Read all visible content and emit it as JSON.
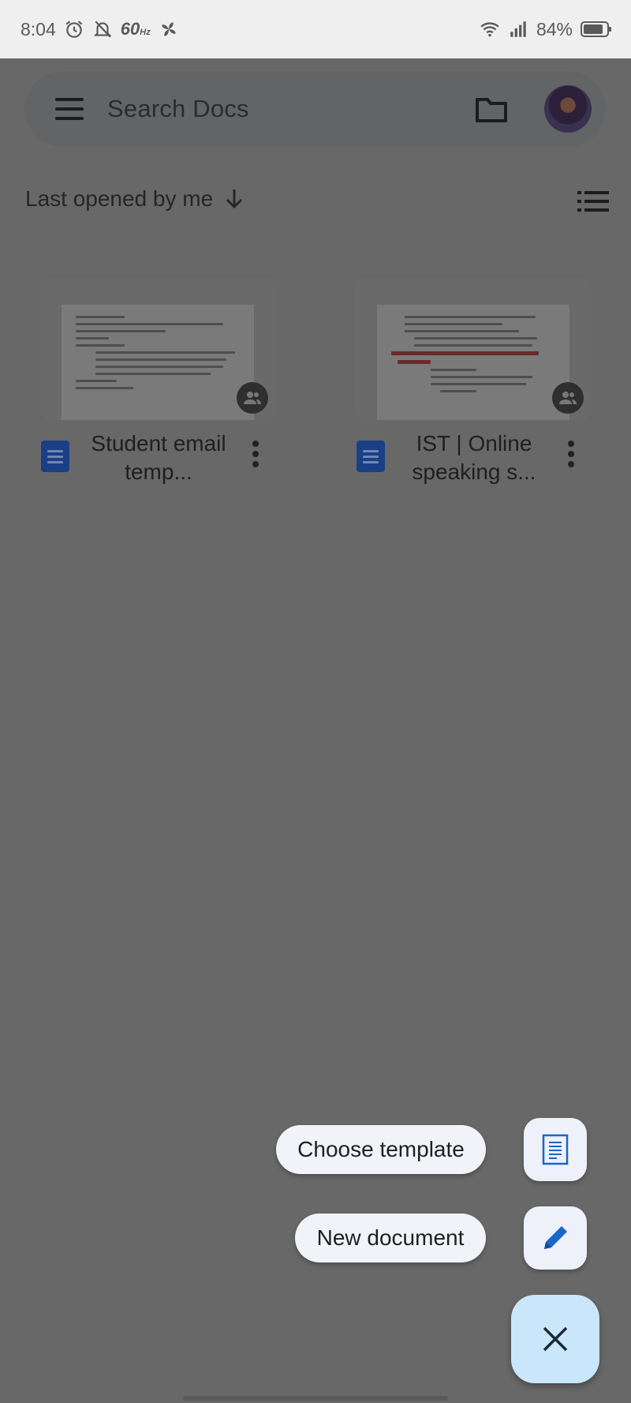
{
  "status_bar": {
    "time": "8:04",
    "refresh_rate": "60",
    "refresh_unit": "Hz",
    "battery": "84%",
    "icons": [
      "alarm-icon",
      "silent-icon",
      "fan-icon",
      "wifi-icon",
      "signal-icon",
      "battery-icon"
    ]
  },
  "search": {
    "placeholder": "Search Docs"
  },
  "sort": {
    "label": "Last opened by me"
  },
  "documents": [
    {
      "title": "Student email temp...",
      "shared": true
    },
    {
      "title": "IST | Online speaking s...",
      "shared": true
    }
  ],
  "fab_menu": {
    "choose_template_label": "Choose template",
    "new_document_label": "New document"
  },
  "colors": {
    "scrim": "#686868",
    "fab_background": "#c9e6fb",
    "mini_fab_background": "#eef1f9",
    "docs_blue": "#1a73e8"
  }
}
